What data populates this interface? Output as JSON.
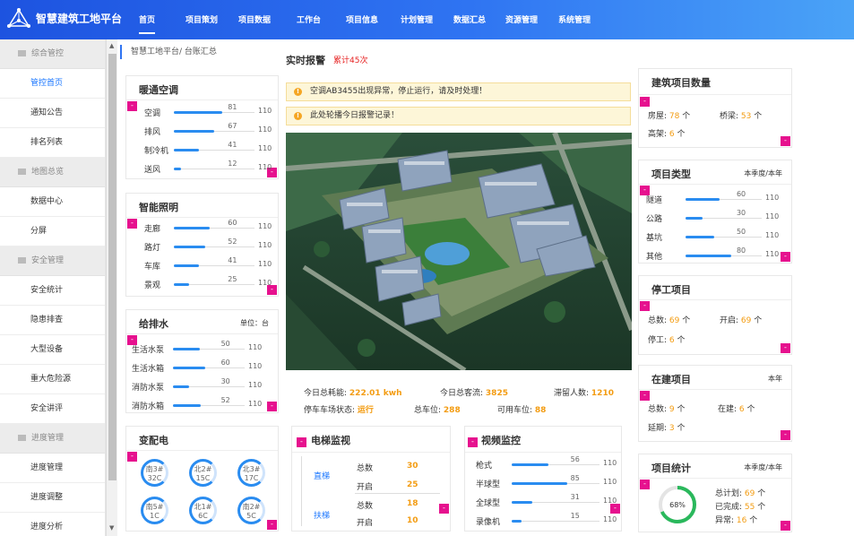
{
  "app": {
    "title": "智慧建筑工地平台"
  },
  "nav": [
    "首页",
    "项目策划",
    "项目数据",
    "工作台",
    "项目信息",
    "计划管理",
    "数据汇总",
    "资源管理",
    "系统管理"
  ],
  "sidebar": [
    {
      "type": "group",
      "label": "综合管控"
    },
    {
      "type": "item",
      "label": "管控首页",
      "active": true
    },
    {
      "type": "item",
      "label": "通知公告"
    },
    {
      "type": "item",
      "label": "排名列表"
    },
    {
      "type": "group",
      "label": "地图总览"
    },
    {
      "type": "item",
      "label": "数据中心"
    },
    {
      "type": "item",
      "label": "分屏"
    },
    {
      "type": "group",
      "label": "安全管理"
    },
    {
      "type": "item",
      "label": "安全统计"
    },
    {
      "type": "item",
      "label": "隐患排查"
    },
    {
      "type": "item",
      "label": "大型设备"
    },
    {
      "type": "item",
      "label": "重大危险源"
    },
    {
      "type": "item",
      "label": "安全讲评"
    },
    {
      "type": "group",
      "label": "进度管理"
    },
    {
      "type": "item",
      "label": "进度管理"
    },
    {
      "type": "item",
      "label": "进度调整"
    },
    {
      "type": "item",
      "label": "进度分析"
    }
  ],
  "breadcrumb": "智慧工地平台/ 台账汇总",
  "markers": {
    "minus": "-"
  },
  "hvac": {
    "title": "暖通空调",
    "rows": [
      {
        "label": "空调",
        "value": 81,
        "max": 110
      },
      {
        "label": "排风",
        "value": 67,
        "max": 110
      },
      {
        "label": "制冷机",
        "value": 41,
        "max": 110
      },
      {
        "label": "送风",
        "value": 12,
        "max": 110
      }
    ]
  },
  "lighting": {
    "title": "智能照明",
    "rows": [
      {
        "label": "走廊",
        "value": 60,
        "max": 110
      },
      {
        "label": "路灯",
        "value": 52,
        "max": 110
      },
      {
        "label": "车库",
        "value": 41,
        "max": 110
      },
      {
        "label": "景观",
        "value": 25,
        "max": 110
      }
    ]
  },
  "water": {
    "title": "给排水",
    "unit": "单位：台",
    "rows": [
      {
        "label": "生活水泵",
        "value": 50,
        "max": 110
      },
      {
        "label": "生活水箱",
        "value": 60,
        "max": 110
      },
      {
        "label": "消防水泵",
        "value": 30,
        "max": 110
      },
      {
        "label": "消防水箱",
        "value": 52,
        "max": 110
      }
    ]
  },
  "substation": {
    "title": "变配电",
    "rings": [
      {
        "name": "南3#",
        "temp": "32C",
        "level": 0.8
      },
      {
        "name": "北2#",
        "temp": "15C",
        "level": 0.6
      },
      {
        "name": "北3#",
        "temp": "17C",
        "level": 0.6
      },
      {
        "name": "南5#",
        "temp": "1C",
        "level": 0.3
      },
      {
        "name": "北1#",
        "temp": "6C",
        "level": 0.4
      },
      {
        "name": "南2#",
        "temp": "5C",
        "level": 0.4
      }
    ]
  },
  "report": {
    "title": "实时报警",
    "count": "累计45次",
    "alerts": [
      "空调AB3455出现异常，停止运行，请及时处理！",
      "此处轮播今日报警记录！"
    ]
  },
  "stats": {
    "energy_label": "今日总耗能:",
    "energy": "222.01 kwh",
    "flow_label": "今日总客流:",
    "flow": "3825",
    "stay_label": "滞留人数:",
    "stay": "1210",
    "park_label": "停车车场状态:",
    "park": "运行",
    "total_label": "总车位:",
    "total": "288",
    "avail_label": "可用车位:",
    "avail": "88"
  },
  "elevator": {
    "title": "电梯监视",
    "groups": [
      {
        "name": "直梯",
        "rows": [
          {
            "k": "总数",
            "v": "30"
          },
          {
            "k": "开启",
            "v": "25"
          }
        ]
      },
      {
        "name": "扶梯",
        "rows": [
          {
            "k": "总数",
            "v": "18"
          },
          {
            "k": "开启",
            "v": "10"
          }
        ]
      }
    ]
  },
  "video": {
    "title": "视频监控",
    "rows": [
      {
        "label": "枪式",
        "value": 56,
        "max": 110
      },
      {
        "label": "半球型",
        "value": 85,
        "max": 110
      },
      {
        "label": "全球型",
        "value": 31,
        "max": 110
      },
      {
        "label": "录像机",
        "value": 15,
        "max": 110
      }
    ]
  },
  "buildings": {
    "title": "建筑项目数量",
    "items": [
      {
        "k": "房屋:",
        "v": "78",
        "u": "个"
      },
      {
        "k": "桥梁:",
        "v": "53",
        "u": "个"
      },
      {
        "k": "高架:",
        "v": "6",
        "u": "个"
      }
    ]
  },
  "ptype": {
    "title": "项目类型",
    "period": "本季度/本年",
    "rows": [
      {
        "label": "隧道",
        "value": 60,
        "max": 110
      },
      {
        "label": "公路",
        "value": 30,
        "max": 110
      },
      {
        "label": "基坑",
        "value": 50,
        "max": 110
      },
      {
        "label": "其他",
        "value": 80,
        "max": 110
      }
    ]
  },
  "stopped": {
    "title": "停工项目",
    "items": [
      {
        "k": "总数:",
        "v": "69",
        "u": "个"
      },
      {
        "k": "开启:",
        "v": "69",
        "u": "个"
      },
      {
        "k": "停工:",
        "v": "6",
        "u": "个"
      }
    ]
  },
  "building": {
    "title": "在建项目",
    "period": "本年",
    "items": [
      {
        "k": "总数:",
        "v": "9",
        "u": "个"
      },
      {
        "k": "在建:",
        "v": "6",
        "u": "个"
      },
      {
        "k": "延期:",
        "v": "3",
        "u": "个"
      }
    ]
  },
  "pstats": {
    "title": "项目统计",
    "period": "本季度/本年",
    "percent": "68%",
    "ratio": 0.68,
    "items": [
      {
        "k": "总计划:",
        "v": "69",
        "u": "个"
      },
      {
        "k": "已完成:",
        "v": "55",
        "u": "个"
      },
      {
        "k": "异常:",
        "v": "16",
        "u": "个"
      }
    ]
  },
  "colors": {
    "accent": "#2a8cf0",
    "marker": "#e6118e",
    "highlight": "#f39c12",
    "alarm": "#e62020",
    "ring": "#2ab85c"
  }
}
